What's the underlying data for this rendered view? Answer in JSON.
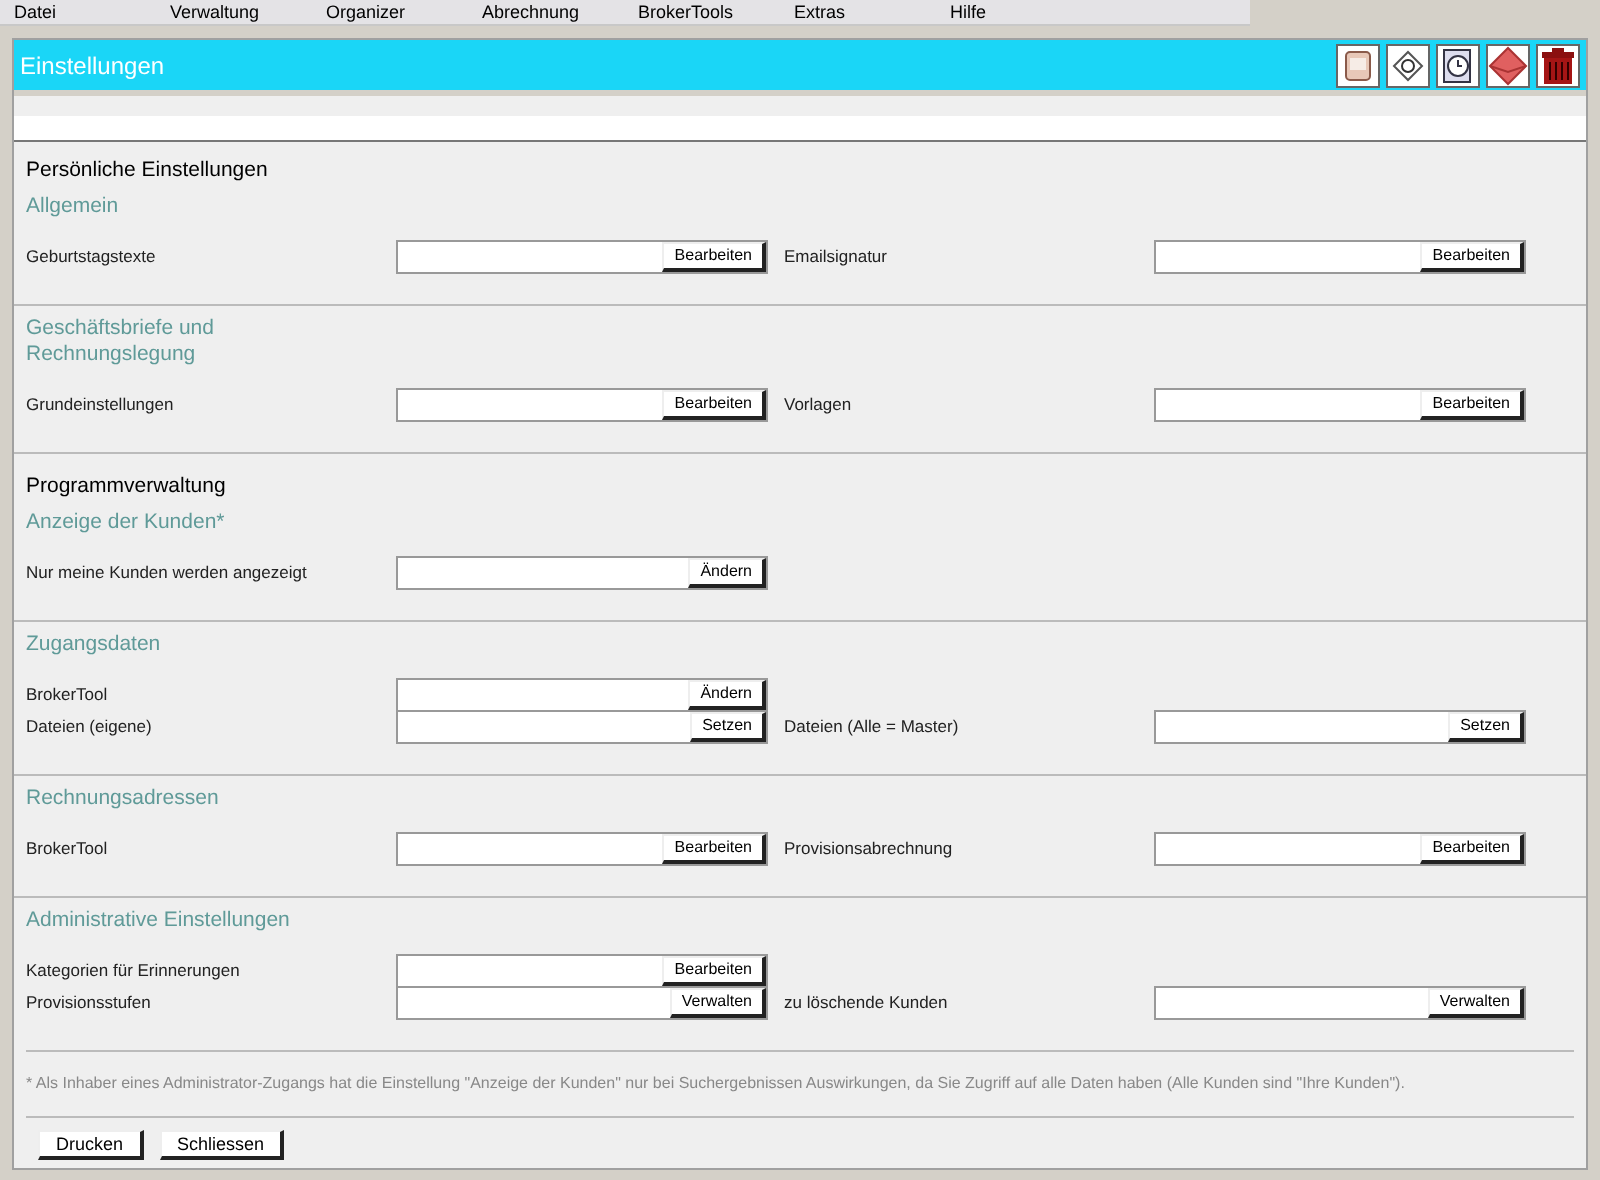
{
  "menu": [
    "Datei",
    "Verwaltung",
    "Organizer",
    "Abrechnung",
    "BrokerTools",
    "Extras",
    "Hilfe"
  ],
  "window": {
    "title": "Einstellungen"
  },
  "sections": [
    {
      "kind": "heading",
      "text": "Persönliche Einstellungen"
    },
    {
      "kind": "group",
      "title": "Allgemein",
      "rows": [
        [
          {
            "label": "Geburtstagstexte",
            "button": "Bearbeiten"
          },
          {
            "label": "Emailsignatur",
            "button": "Bearbeiten"
          }
        ]
      ]
    },
    {
      "kind": "group",
      "title": "Geschäftsbriefe und Rechnungslegung",
      "rows": [
        [
          {
            "label": "Grundeinstellungen",
            "button": "Bearbeiten"
          },
          {
            "label": "Vorlagen",
            "button": "Bearbeiten"
          }
        ]
      ]
    },
    {
      "kind": "heading",
      "text": "Programmverwaltung"
    },
    {
      "kind": "group",
      "title": "Anzeige der Kunden*",
      "rows": [
        [
          {
            "label": "Nur meine Kunden werden angezeigt",
            "button": "Ändern"
          }
        ]
      ]
    },
    {
      "kind": "group",
      "title": "Zugangsdaten",
      "rows": [
        [
          {
            "label": "BrokerTool",
            "button": "Ändern"
          }
        ],
        [
          {
            "label": "Dateien (eigene)",
            "button": "Setzen"
          },
          {
            "label": "Dateien (Alle = Master)",
            "button": "Setzen"
          }
        ]
      ]
    },
    {
      "kind": "group",
      "title": "Rechnungsadressen",
      "rows": [
        [
          {
            "label": "BrokerTool",
            "button": "Bearbeiten"
          },
          {
            "label": "Provisionsabrechnung",
            "button": "Bearbeiten"
          }
        ]
      ]
    },
    {
      "kind": "group",
      "title": "Administrative Einstellungen",
      "rows": [
        [
          {
            "label": "Kategorien für Erinnerungen",
            "button": "Bearbeiten"
          }
        ],
        [
          {
            "label": "Provisionsstufen",
            "button": "Verwalten"
          },
          {
            "label": "zu löschende Kunden",
            "button": "Verwalten"
          }
        ]
      ]
    }
  ],
  "footnote": "* Als Inhaber eines Administrator-Zugangs hat die Einstellung \"Anzeige der Kunden\" nur bei Suchergebnissen Auswirkungen, da Sie Zugriff auf alle Daten haben (Alle Kunden sind \"Ihre Kunden\").",
  "buttons": [
    "Drucken",
    "Schliessen"
  ]
}
